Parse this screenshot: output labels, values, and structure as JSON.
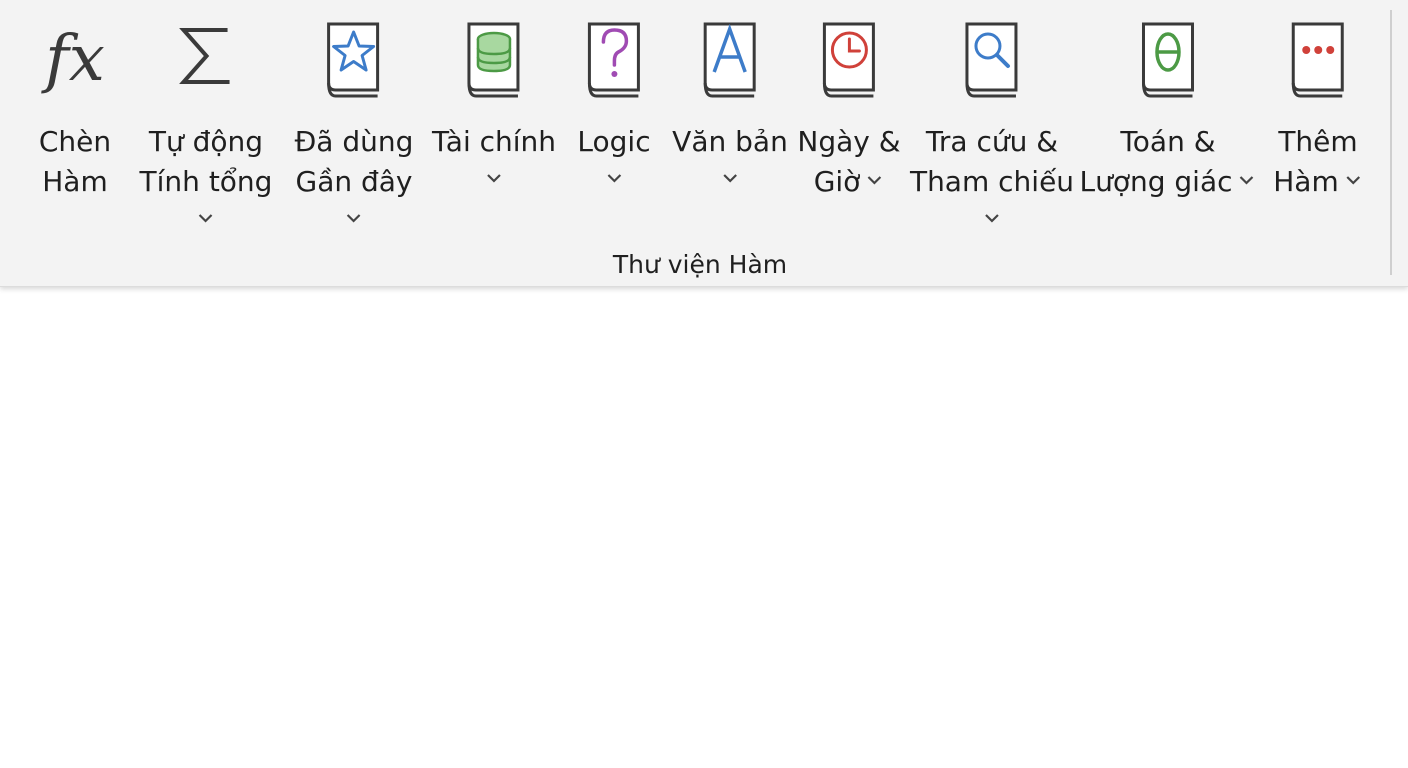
{
  "ribbon": {
    "group_label": "Thư viện Hàm",
    "commands": [
      {
        "id": "insert-function",
        "line1": "Chèn",
        "line2": "Hàm",
        "icon": "fx-icon"
      },
      {
        "id": "autosum",
        "line1": "Tự động",
        "line2": "Tính tổng",
        "icon": "sigma-icon"
      },
      {
        "id": "recently-used",
        "line1": "Đã dùng",
        "line2": "Gần đây",
        "icon": "book-star-icon",
        "color": "#3d7cc9"
      },
      {
        "id": "financial",
        "line1": "Tài chính",
        "icon": "book-coins-icon",
        "color": "#4c9a45"
      },
      {
        "id": "logical",
        "line1": "Logic",
        "icon": "book-question-icon",
        "color": "#a04bb3"
      },
      {
        "id": "text",
        "line1": "Văn bản",
        "icon": "book-letter-a-icon",
        "color": "#3d7cc9"
      },
      {
        "id": "date-time",
        "line1": "Ngày &",
        "line2": "Giờ",
        "icon": "book-clock-icon",
        "color": "#d0413a"
      },
      {
        "id": "lookup-reference",
        "line1": "Tra cứu &",
        "line2": "Tham chiếu",
        "icon": "book-magnifier-icon",
        "color": "#3d7cc9"
      },
      {
        "id": "math-trig",
        "line1": "Toán &",
        "line2": "Lượng giác",
        "icon": "book-theta-icon",
        "color": "#4c9a45"
      },
      {
        "id": "more-functions",
        "line1": "Thêm",
        "line2": "Hàm",
        "icon": "book-dots-icon",
        "color": "#d0413a"
      }
    ]
  }
}
